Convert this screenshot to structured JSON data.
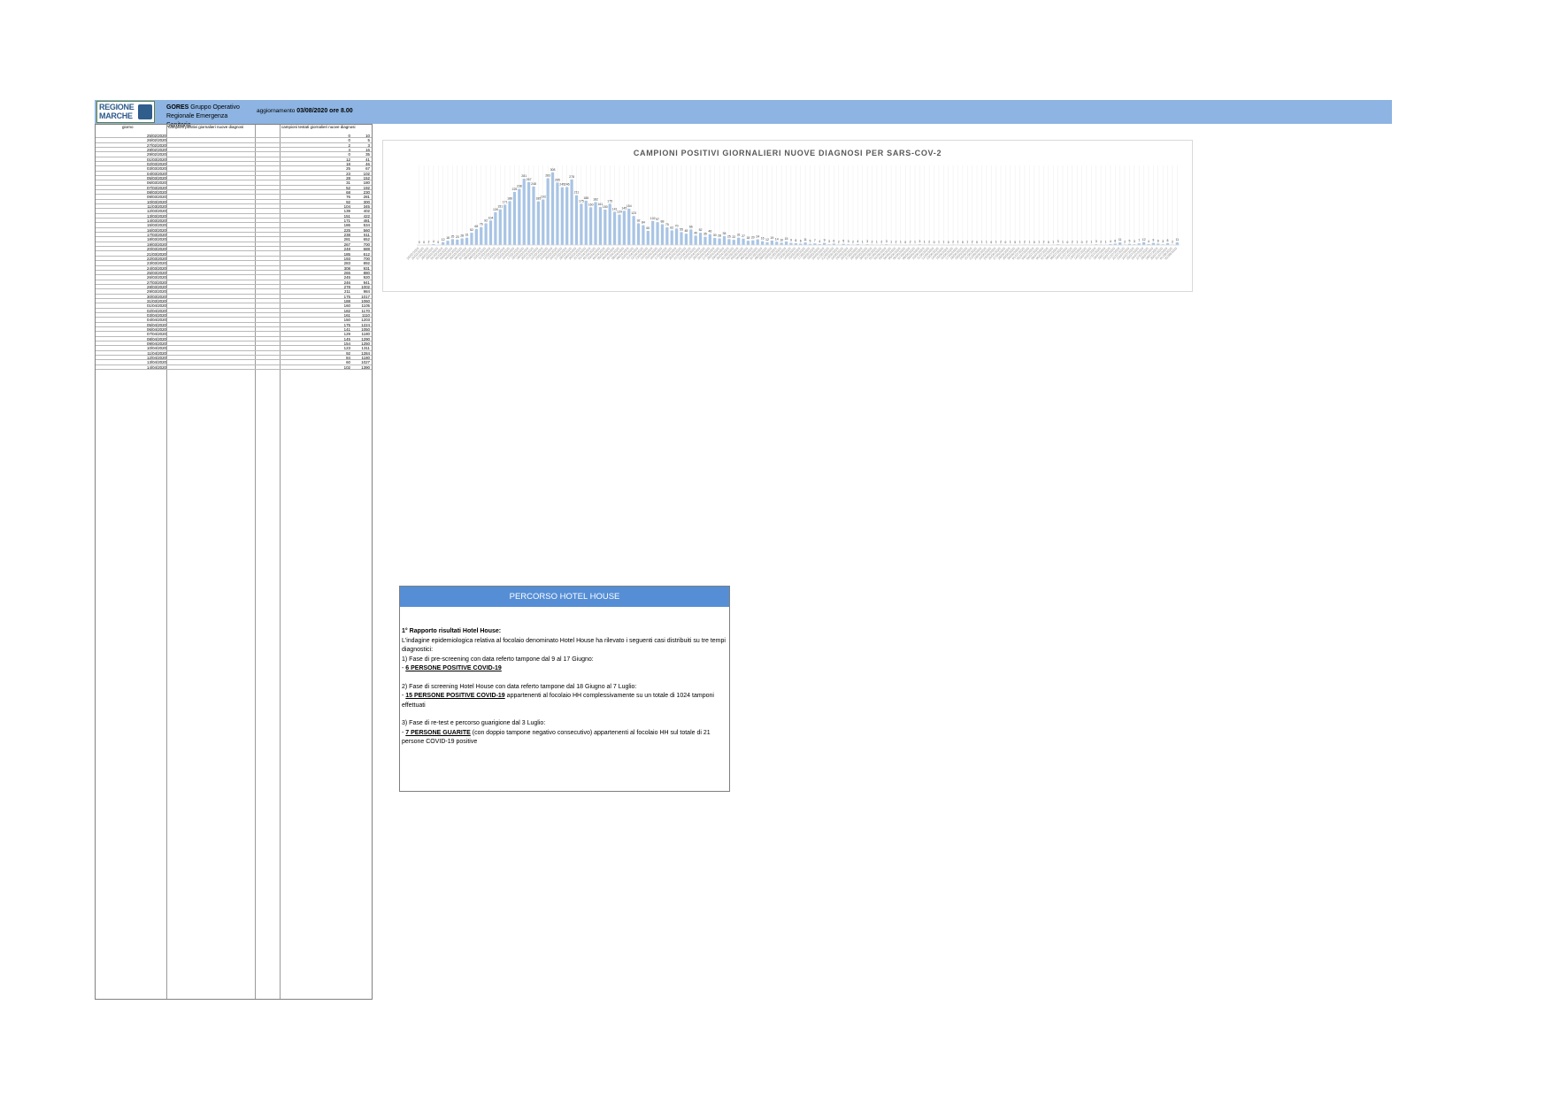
{
  "header": {
    "logo_line1": "REGIONE",
    "logo_line2": "MARCHE",
    "gores_bold": "GORES",
    "gores_rest": "Gruppo Operativo Regionale Emergenza Sanitaria",
    "aggiornamento_label": "aggiornamento",
    "aggiornamento_value": "03/08/2020 ore 8.00",
    "accent_color": "#8db4e2"
  },
  "table": {
    "headers": [
      "giorno",
      "campioni positivi giornalieri nuove diagnosi",
      "campioni testati giornalieri nuove diagnosi"
    ],
    "rows": [
      [
        "25/02/2020",
        "0",
        "10"
      ],
      [
        "26/02/2020",
        "0",
        "5"
      ],
      [
        "27/02/2020",
        "2",
        "3"
      ],
      [
        "28/02/2020",
        "4",
        "16"
      ],
      [
        "29/02/2020",
        "0",
        "35"
      ],
      [
        "01/03/2020",
        "12",
        "41"
      ],
      [
        "02/03/2020",
        "18",
        "46"
      ],
      [
        "03/03/2020",
        "25",
        "67"
      ],
      [
        "04/03/2020",
        "23",
        "102"
      ],
      [
        "05/03/2020",
        "28",
        "152"
      ],
      [
        "06/03/2020",
        "31",
        "180"
      ],
      [
        "07/03/2020",
        "52",
        "192"
      ],
      [
        "08/03/2020",
        "68",
        "230"
      ],
      [
        "09/03/2020",
        "76",
        "281"
      ],
      [
        "10/03/2020",
        "92",
        "300"
      ],
      [
        "11/03/2020",
        "104",
        "345"
      ],
      [
        "12/03/2020",
        "139",
        "402"
      ],
      [
        "13/03/2020",
        "151",
        "422"
      ],
      [
        "14/03/2020",
        "171",
        "481"
      ],
      [
        "15/03/2020",
        "186",
        "534"
      ],
      [
        "16/03/2020",
        "225",
        "560"
      ],
      [
        "17/03/2020",
        "238",
        "611"
      ],
      [
        "18/03/2020",
        "281",
        "652"
      ],
      [
        "19/03/2020",
        "267",
        "700"
      ],
      [
        "20/03/2020",
        "248",
        "688"
      ],
      [
        "21/03/2020",
        "185",
        "612"
      ],
      [
        "22/03/2020",
        "193",
        "700"
      ],
      [
        "23/03/2020",
        "283",
        "892"
      ],
      [
        "24/03/2020",
        "308",
        "931"
      ],
      [
        "25/03/2020",
        "265",
        "880"
      ],
      [
        "26/03/2020",
        "245",
        "920"
      ],
      [
        "27/03/2020",
        "246",
        "941"
      ],
      [
        "28/03/2020",
        "278",
        "1002"
      ],
      [
        "29/03/2020",
        "211",
        "984"
      ],
      [
        "30/03/2020",
        "175",
        "1017"
      ],
      [
        "31/03/2020",
        "188",
        "1060"
      ],
      [
        "01/04/2020",
        "160",
        "1105"
      ],
      [
        "02/04/2020",
        "182",
        "1170"
      ],
      [
        "03/04/2020",
        "161",
        "1110"
      ],
      [
        "04/04/2020",
        "150",
        "1203"
      ],
      [
        "05/04/2020",
        "175",
        "1224"
      ],
      [
        "06/04/2020",
        "141",
        "1050"
      ],
      [
        "07/04/2020",
        "129",
        "1180"
      ],
      [
        "08/04/2020",
        "145",
        "1290"
      ],
      [
        "09/04/2020",
        "154",
        "1250"
      ],
      [
        "10/04/2020",
        "123",
        "1311"
      ],
      [
        "11/04/2020",
        "92",
        "1284"
      ],
      [
        "12/04/2020",
        "84",
        "1180"
      ],
      [
        "13/04/2020",
        "60",
        "1027"
      ],
      [
        "14/04/2020",
        "102",
        "1390"
      ]
    ]
  },
  "chart_data": {
    "type": "bar",
    "title": "CAMPIONI POSITIVI GIORNALIERI NUOVE DIAGNOSI PER SARS-COV-2",
    "bar_color": "#a9c4e4",
    "grid": true,
    "ylim": [
      0,
      300
    ],
    "categories": [
      "25/02/2020",
      "26/02/2020",
      "27/02/2020",
      "28/02/2020",
      "29/02/2020",
      "01/03/2020",
      "02/03/2020",
      "03/03/2020",
      "04/03/2020",
      "05/03/2020",
      "06/03/2020",
      "07/03/2020",
      "08/03/2020",
      "09/03/2020",
      "10/03/2020",
      "11/03/2020",
      "12/03/2020",
      "13/03/2020",
      "14/03/2020",
      "15/03/2020",
      "16/03/2020",
      "17/03/2020",
      "18/03/2020",
      "19/03/2020",
      "20/03/2020",
      "21/03/2020",
      "22/03/2020",
      "23/03/2020",
      "24/03/2020",
      "25/03/2020",
      "26/03/2020",
      "27/03/2020",
      "28/03/2020",
      "29/03/2020",
      "30/03/2020",
      "31/03/2020",
      "01/04/2020",
      "02/04/2020",
      "03/04/2020",
      "04/04/2020",
      "05/04/2020",
      "06/04/2020",
      "07/04/2020",
      "08/04/2020",
      "09/04/2020",
      "10/04/2020",
      "11/04/2020",
      "12/04/2020",
      "13/04/2020",
      "14/04/2020",
      "15/04/2020",
      "16/04/2020",
      "17/04/2020",
      "18/04/2020",
      "19/04/2020",
      "20/04/2020",
      "21/04/2020",
      "22/04/2020",
      "23/04/2020",
      "24/04/2020",
      "25/04/2020",
      "26/04/2020",
      "27/04/2020",
      "28/04/2020",
      "29/04/2020",
      "30/04/2020",
      "01/05/2020",
      "02/05/2020",
      "03/05/2020",
      "04/05/2020",
      "05/05/2020",
      "06/05/2020",
      "07/05/2020",
      "08/05/2020",
      "09/05/2020",
      "10/05/2020",
      "11/05/2020",
      "12/05/2020",
      "13/05/2020",
      "14/05/2020",
      "15/05/2020",
      "16/05/2020",
      "17/05/2020",
      "18/05/2020",
      "19/05/2020",
      "20/05/2020",
      "21/05/2020",
      "22/05/2020",
      "23/05/2020",
      "24/05/2020",
      "25/05/2020",
      "26/05/2020",
      "27/05/2020",
      "28/05/2020",
      "29/05/2020",
      "30/05/2020",
      "31/05/2020",
      "01/06/2020",
      "02/06/2020",
      "03/06/2020",
      "04/06/2020",
      "05/06/2020",
      "06/06/2020",
      "07/06/2020",
      "08/06/2020",
      "09/06/2020",
      "10/06/2020",
      "11/06/2020",
      "12/06/2020",
      "13/06/2020",
      "14/06/2020",
      "15/06/2020",
      "16/06/2020",
      "17/06/2020",
      "18/06/2020",
      "19/06/2020",
      "20/06/2020",
      "21/06/2020",
      "22/06/2020",
      "23/06/2020",
      "24/06/2020",
      "25/06/2020",
      "26/06/2020",
      "27/06/2020",
      "28/06/2020",
      "29/06/2020",
      "30/06/2020",
      "01/07/2020",
      "02/07/2020",
      "03/07/2020",
      "04/07/2020",
      "05/07/2020",
      "06/07/2020",
      "07/07/2020",
      "08/07/2020",
      "09/07/2020",
      "10/07/2020",
      "11/07/2020",
      "12/07/2020",
      "13/07/2020",
      "14/07/2020",
      "15/07/2020",
      "16/07/2020",
      "17/07/2020",
      "18/07/2020",
      "19/07/2020",
      "20/07/2020",
      "21/07/2020",
      "22/07/2020",
      "23/07/2020",
      "24/07/2020",
      "25/07/2020",
      "26/07/2020",
      "27/07/2020",
      "28/07/2020",
      "29/07/2020",
      "30/07/2020",
      "31/07/2020",
      "01/08/2020",
      "02/08/2020"
    ],
    "values": [
      0,
      0,
      2,
      4,
      0,
      12,
      18,
      25,
      23,
      28,
      31,
      52,
      68,
      76,
      92,
      104,
      139,
      151,
      171,
      186,
      225,
      238,
      281,
      267,
      248,
      185,
      193,
      283,
      308,
      265,
      245,
      246,
      278,
      211,
      175,
      188,
      160,
      182,
      161,
      150,
      175,
      141,
      129,
      145,
      154,
      123,
      92,
      84,
      60,
      102,
      97,
      88,
      75,
      62,
      70,
      55,
      48,
      66,
      40,
      52,
      35,
      46,
      30,
      28,
      38,
      25,
      22,
      31,
      27,
      18,
      20,
      24,
      16,
      12,
      19,
      14,
      10,
      15,
      9,
      8,
      6,
      11,
      5,
      7,
      4,
      9,
      3,
      6,
      2,
      5,
      3,
      2,
      4,
      1,
      3,
      2,
      1,
      2,
      3,
      1,
      2,
      1,
      0,
      2,
      1,
      3,
      1,
      2,
      0,
      1,
      1,
      0,
      2,
      1,
      0,
      1,
      2,
      0,
      1,
      1,
      0,
      1,
      2,
      0,
      1,
      0,
      1,
      2,
      1,
      0,
      1,
      2,
      0,
      1,
      3,
      1,
      0,
      2,
      1,
      0,
      2,
      1,
      3,
      2,
      1,
      4,
      6,
      11,
      2,
      5,
      3,
      7,
      12,
      4,
      9,
      6,
      3,
      8,
      2,
      11
    ]
  },
  "hotel_house": {
    "title": "PERCORSO HOTEL HOUSE",
    "lines": [
      "1° Rapporto risultati Hotel House:",
      "L'indagine epidemiologica relativa al focolaio denominato Hotel House ha rilevato i seguenti casi distribuiti su tre tempi diagnostici:",
      "1) Fase di pre-screening con data referto tampone dal 9 al 17 Giugno:",
      "6 PERSONE POSITIVE COVID-19",
      "2) Fase di screening Hotel House con data referto tampone dal 18 Giugno al 7 Luglio:",
      "15 PERSONE POSITIVE COVID-19",
      "appartenenti al focolaio HH complessivamente su un totale di 1024 tamponi effettuati",
      "3) Fase di re-test e percorso guarigione dal 3 Luglio:",
      "7 PERSONE GUARITE",
      "(con doppio tampone negativo consecutivo) appartenenti al focolaio HH sul totale di 21 persone COVID-19 positive"
    ],
    "title_color": "#558ed5"
  }
}
